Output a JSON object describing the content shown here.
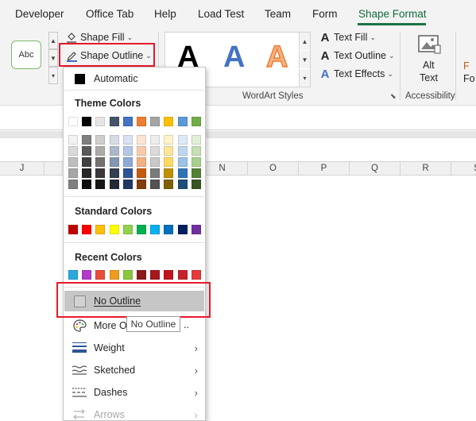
{
  "tabs": [
    {
      "label": "Developer",
      "active": false
    },
    {
      "label": "Office Tab",
      "active": false
    },
    {
      "label": "Help",
      "active": false
    },
    {
      "label": "Load Test",
      "active": false
    },
    {
      "label": "Team",
      "active": false
    },
    {
      "label": "Form",
      "active": false
    },
    {
      "label": "Shape Format",
      "active": true
    }
  ],
  "ribbon": {
    "shape_style_thumb": "Abc",
    "shape_fill_label": "Shape Fill",
    "shape_outline_label": "Shape Outline",
    "wordart_sample_letter": "A",
    "text_fill_label": "Text Fill",
    "text_outline_label": "Text Outline",
    "text_effects_label": "Text Effects",
    "wordart_group_label": "WordArt Styles",
    "alt_text_line1": "Alt",
    "alt_text_line2": "Text",
    "accessibility_group_label": "Accessibility",
    "partial_next_line1": "F",
    "partial_next_line2": "Fo"
  },
  "columns": [
    "J",
    "N",
    "O",
    "P",
    "Q",
    "R",
    "S"
  ],
  "menu": {
    "automatic_label": "Automatic",
    "theme_colors_heading": "Theme Colors",
    "theme_colors": [
      [
        "#ffffff",
        "#f2f2f2",
        "#d9d9d9",
        "#bfbfbf",
        "#a6a6a6",
        "#808080"
      ],
      [
        "#000000",
        "#7f7f7f",
        "#595959",
        "#404040",
        "#262626",
        "#0d0d0d"
      ],
      [
        "#e7e6e6",
        "#d0cece",
        "#aeaaaa",
        "#757171",
        "#3a3838",
        "#171616"
      ],
      [
        "#44546a",
        "#d6dce4",
        "#adb9ca",
        "#8496b0",
        "#333f4f",
        "#222a35"
      ],
      [
        "#4472c4",
        "#d9e2f3",
        "#b4c6e7",
        "#8eaadb",
        "#2f5496",
        "#1f3864"
      ],
      [
        "#ed7d31",
        "#fbe5d5",
        "#f7cbac",
        "#f4b183",
        "#c55a11",
        "#833c0b"
      ],
      [
        "#a5a5a5",
        "#ededed",
        "#dbdbdb",
        "#c9c9c9",
        "#7b7b7b",
        "#525252"
      ],
      [
        "#ffc000",
        "#fff2cc",
        "#fee599",
        "#ffd965",
        "#bf9000",
        "#7f6000"
      ],
      [
        "#5b9bd5",
        "#deebf6",
        "#bdd7ee",
        "#9cc3e5",
        "#2e75b5",
        "#1e4e79"
      ],
      [
        "#70ad47",
        "#e2efd9",
        "#c5e0b3",
        "#a8d08d",
        "#538135",
        "#375623"
      ]
    ],
    "standard_colors_heading": "Standard Colors",
    "standard_colors": [
      "#c00000",
      "#ff0000",
      "#ffc000",
      "#ffff00",
      "#92d050",
      "#00b050",
      "#00b0f0",
      "#0070c0",
      "#002060",
      "#7030a0"
    ],
    "recent_colors_heading": "Recent Colors",
    "recent_colors": [
      "#29a8e0",
      "#b33ac8",
      "#e84c3d",
      "#f09a1e",
      "#8cc63f",
      "#8b1a1a",
      "#a3171d",
      "#c0141e",
      "#c8202a",
      "#e53a3a"
    ],
    "no_outline_label": "No Outline",
    "more_colors_label": "More O",
    "weight_label": "Weight",
    "sketched_label": "Sketched",
    "dashes_label": "Dashes",
    "arrows_label": "Arrows"
  },
  "tooltip": "No Outline",
  "colors": {
    "accent_green": "#1e7145",
    "highlight_red": "#e8192c",
    "hover_gray": "#c6c6c6",
    "wordart_blue": "#4472c4",
    "wordart_orange": "#f4b183"
  }
}
